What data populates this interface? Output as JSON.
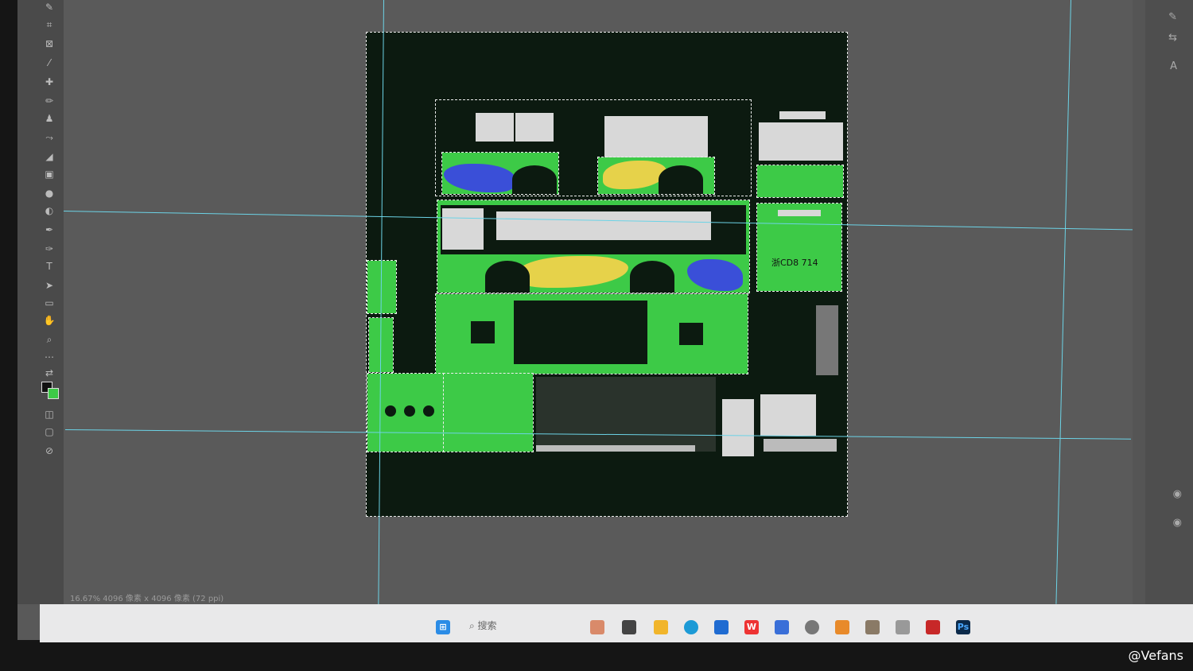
{
  "statusbar": {
    "text": "16.67%  4096 像素 x 4096 像素 (72 ppi)"
  },
  "texture": {
    "plate": "浙CD8 714"
  },
  "taskbar": {
    "search_placeholder": "搜索",
    "icons": [
      "windows-start",
      "search",
      "widgets",
      "task-view",
      "file-explorer",
      "edge",
      "mail",
      "wps",
      "store",
      "chrome",
      "office",
      "app-a",
      "app-b",
      "acrobat",
      "photoshop"
    ]
  },
  "watermark": "@Vefans",
  "colors": {
    "accent_guide": "#6cd3e6",
    "texture_green": "#3dca47",
    "bg_dark": "#0c1a10"
  }
}
